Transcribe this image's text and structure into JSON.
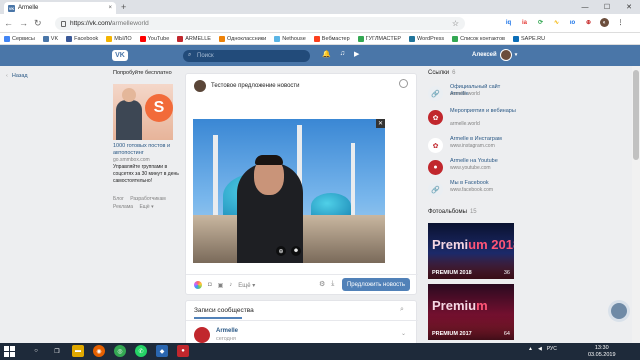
{
  "browser": {
    "tab_title": "Armelle",
    "tab_close": "×",
    "new_tab": "+",
    "controls": {
      "minimize": "—",
      "maximize": "☐",
      "close": "✕"
    },
    "nav": {
      "back": "←",
      "forward": "→",
      "reload": "↻"
    },
    "url_host": "https://vk.com/",
    "url_path": "armelleworld",
    "star": "☆",
    "extensions": [
      "iq",
      "ia",
      "⟳",
      "∿",
      "ιο",
      "⊕",
      "◐"
    ],
    "menu": "⋮"
  },
  "bookmarks": [
    {
      "label": "Сервисы",
      "color": "#4285f4"
    },
    {
      "label": "VK",
      "color": "#4a76a8"
    },
    {
      "label": "Facebook",
      "color": "#3b5998"
    },
    {
      "label": "МЫЛО",
      "color": "#f4b400"
    },
    {
      "label": "YouTube",
      "color": "#ff0000"
    },
    {
      "label": "ARMELLE",
      "color": "#c1272d"
    },
    {
      "label": "Одноклассники",
      "color": "#ee8208"
    },
    {
      "label": "Nethouse",
      "color": "#5bb5e5"
    },
    {
      "label": "Вебмастер",
      "color": "#fc3f1d"
    },
    {
      "label": "ГУГЛМАСТЕР",
      "color": "#34a853"
    },
    {
      "label": "WordPress",
      "color": "#21759b"
    },
    {
      "label": "Список контактов",
      "color": "#34a853"
    },
    {
      "label": "SAPE.RU",
      "color": "#0b6db7"
    }
  ],
  "vk": {
    "logo": "VK",
    "search_placeholder": "Поиск",
    "bell": "🔔",
    "music": "♫",
    "play": "▶",
    "user_name": "Алексей",
    "left_nav_arrow": "‹",
    "left_nav": "Назад"
  },
  "ad": {
    "top_text": "Попробуйте бесплатно",
    "badge": "S",
    "title": "1000 готовых постов и автопостинг",
    "url": "go.smmbox.com",
    "desc": "Управляйте группами в соцсетях за 30 минут в день самостоятельно!",
    "links": [
      "Блог",
      "Разработчикам",
      "Реклама",
      "Ещё ▾"
    ]
  },
  "post_form": {
    "title": "Тестовое предложение новости",
    "photo_close": "✕",
    "zoom": "⊕",
    "face": "☻",
    "more": "Ещё ▾",
    "submit": "Предложить новость",
    "settings": "⚙",
    "attach": "⤓"
  },
  "posts": {
    "title": "Записи сообщества",
    "search": "⌕",
    "author": "Armelle",
    "date": "сегодня",
    "chevron": "⌄"
  },
  "links_panel": {
    "title": "Ссылки",
    "count": "6",
    "items": [
      {
        "title": "Официальный сайт Armelle",
        "url": "armelle.world"
      },
      {
        "title": "Мероприятия и вебинары",
        "url": "armelle.world"
      },
      {
        "title": "Armelle в Инстаграм",
        "url": "www.instagram.com"
      },
      {
        "title": "Armelle на Youtube",
        "url": "www.youtube.com"
      },
      {
        "title": "Мы в Facebook",
        "url": "www.facebook.com"
      }
    ]
  },
  "albums": {
    "title": "Фотоальбомы",
    "count": "15",
    "items": [
      {
        "caption": "PREMIUM 2018",
        "count": "36",
        "art_a": "Premi",
        "art_b": "um 2018"
      },
      {
        "caption": "PREMIUM 2017",
        "count": "64",
        "art_a": "Premiu",
        "art_b": "m"
      }
    ]
  },
  "taskbar": {
    "start": "⊞",
    "tray_lang": "РУС",
    "time": "13:30",
    "date": "03.05.2019"
  }
}
